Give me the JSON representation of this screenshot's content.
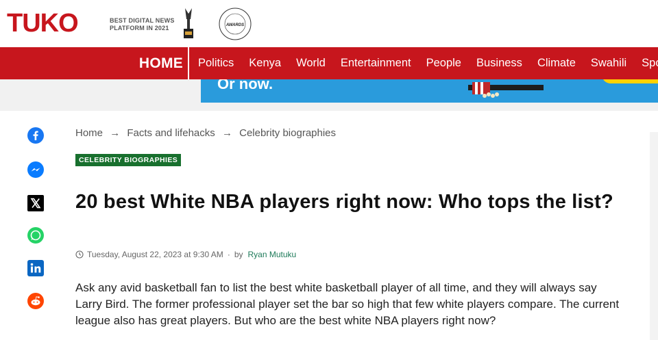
{
  "brand": {
    "name": "TUKO",
    "award_text": "BEST DIGITAL NEWS PLATFORM IN 2021",
    "color": "#c7161d"
  },
  "nav": {
    "home": "HOME",
    "items": [
      "Politics",
      "Kenya",
      "World",
      "Entertainment",
      "People",
      "Business",
      "Climate",
      "Swahili",
      "Spo"
    ]
  },
  "ad": {
    "text": "Or now."
  },
  "social": [
    "facebook-icon",
    "messenger-icon",
    "x-icon",
    "whatsapp-icon",
    "linkedin-icon",
    "reddit-icon"
  ],
  "breadcrumb": {
    "items": [
      "Home",
      "Facts and lifehacks",
      "Celebrity biographies"
    ],
    "separator": "→"
  },
  "article": {
    "category": "CELEBRITY BIOGRAPHIES",
    "title": "20 best White NBA players right now: Who tops the list?",
    "date": "Tuesday, August 22, 2023 at 9:30 AM",
    "by": "by",
    "author": "Ryan Mutuku",
    "lead": "Ask any avid basketball fan to list the best white basketball player of all time, and they will always say Larry Bird. The former professional player set the bar so high that few white players compare. The current league also has great players. But who are the best white NBA players right now?"
  }
}
